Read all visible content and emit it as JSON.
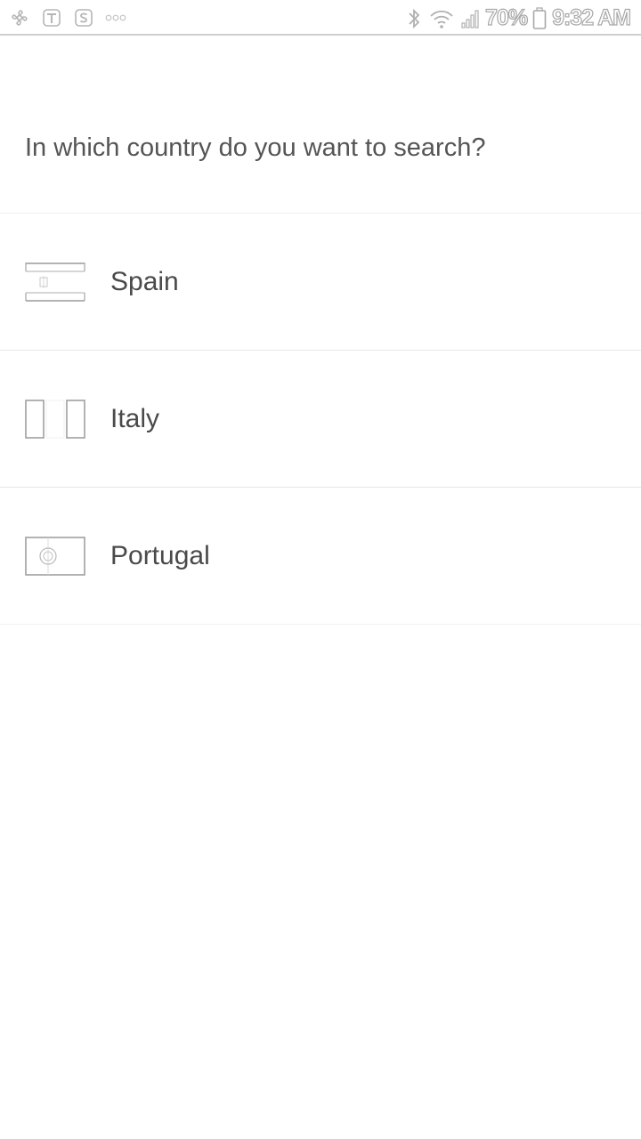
{
  "status_bar": {
    "battery_percent": "70%",
    "time": "9:32 AM",
    "left_icons": [
      "pinwheel-icon",
      "t-app-icon",
      "s-app-icon",
      "more-dots-icon"
    ],
    "right_icons": [
      "bluetooth-icon",
      "wifi-icon",
      "signal-icon",
      "battery-icon"
    ]
  },
  "prompt": {
    "question": "In which country do you want to search?"
  },
  "countries": [
    {
      "name": "Spain",
      "flag_icon": "spain-flag-icon"
    },
    {
      "name": "Italy",
      "flag_icon": "italy-flag-icon"
    },
    {
      "name": "Portugal",
      "flag_icon": "portugal-flag-icon"
    }
  ],
  "colors": {
    "background": "#ffffff",
    "text": "#4a4a4a",
    "divider": "#e6e6e6"
  }
}
